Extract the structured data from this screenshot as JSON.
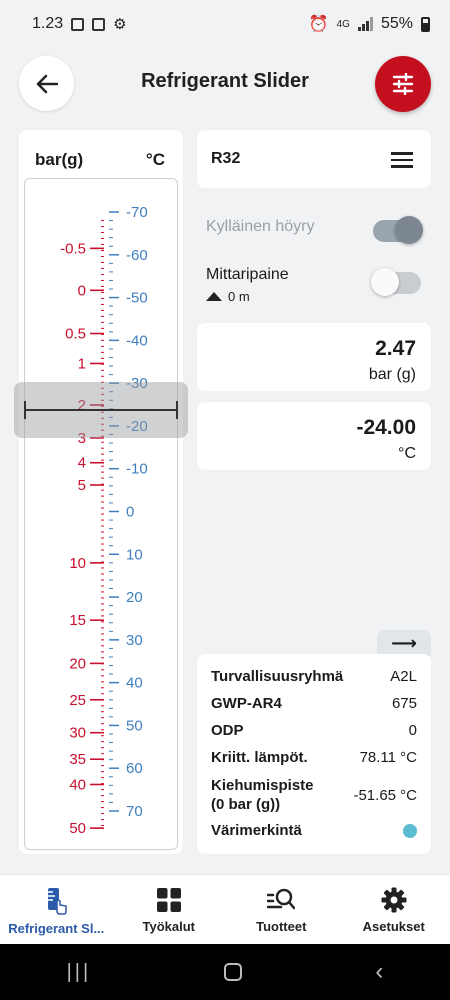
{
  "status": {
    "time": "1.23",
    "network": "4G",
    "battery": "55%"
  },
  "header": {
    "title": "Refrigerant Slider"
  },
  "scale": {
    "left_unit": "bar(g)",
    "right_unit": "°C",
    "pressure_labels": [
      "-0.5",
      "0",
      "0.5",
      "1",
      "2",
      "3",
      "4",
      "5",
      "10",
      "15",
      "20",
      "25",
      "30",
      "35",
      "40",
      "50"
    ],
    "temperature_labels": [
      "-70",
      "-60",
      "-50",
      "-40",
      "-30",
      "-20",
      "-10",
      "0",
      "10",
      "20",
      "30",
      "40",
      "50",
      "60",
      "70"
    ],
    "pressure_color": "#c8102e",
    "temperature_color": "#3f7fc0"
  },
  "refrigerant": {
    "name": "R32"
  },
  "toggles": {
    "saturated_label": "Kylläinen höyry",
    "saturated_on": true,
    "gauge_label": "Mittaripaine",
    "gauge_on": false,
    "altitude": "0 m"
  },
  "readout": {
    "pressure": "2.47",
    "pressure_unit": "bar (g)",
    "temperature": "-24.00",
    "temperature_unit": "°C"
  },
  "properties": {
    "safety_group_label": "Turvallisuusryhmä",
    "safety_group": "A2L",
    "gwp_label": "GWP-AR4",
    "gwp": "675",
    "odp_label": "ODP",
    "odp": "0",
    "crit_label": "Kriitt. lämpöt.",
    "crit": "78.11 °C",
    "boil_label_1": "Kiehumispiste",
    "boil_label_2": "(0 bar (g))",
    "boil": "-51.65 °C",
    "color_label": "Värimerkintä",
    "color_mark": "#5bbcd0"
  },
  "nav": {
    "items": [
      "Refrigerant Sl...",
      "Työkalut",
      "Tuotteet",
      "Asetukset"
    ],
    "active_color": "#2b5aa8"
  },
  "colors": {
    "accent": "#c40f1f"
  }
}
